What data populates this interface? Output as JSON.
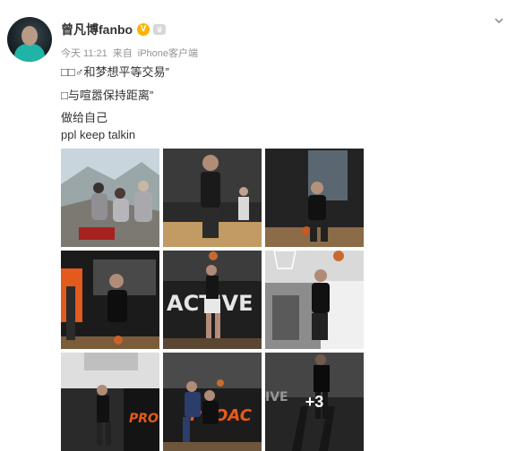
{
  "post": {
    "author": "曾凡博fanbo",
    "verified_badge": "V",
    "member_badge": "♛",
    "time": "今天 11:21",
    "source_prefix": "来自",
    "source": "iPhone客户端",
    "lines": [
      "□□♂和梦想平等交易”",
      "□与喧嚣保持距离”",
      "做给自己",
      "ppl keep talkin"
    ],
    "more_count": "+3"
  },
  "photos": [
    {
      "id": 1,
      "desc": "mountain-group-photo"
    },
    {
      "id": 2,
      "desc": "gym-player-standing"
    },
    {
      "id": 3,
      "desc": "gym-player-dribbling"
    },
    {
      "id": 4,
      "desc": "gym-player-orange-light"
    },
    {
      "id": 5,
      "desc": "active-wall-jump",
      "wall_text": "ACTIVE"
    },
    {
      "id": 6,
      "desc": "dunk-mural"
    },
    {
      "id": 7,
      "desc": "layup-orange-wall",
      "wall_text": "PRO"
    },
    {
      "id": 8,
      "desc": "two-players-pro",
      "wall_text": "PROAC"
    },
    {
      "id": 9,
      "desc": "stairs-walk",
      "wall_text": "IVE"
    }
  ],
  "colors": {
    "name": "#333333",
    "meta": "#939393",
    "verified": "#f7b500",
    "accent_orange": "#e8591a"
  }
}
